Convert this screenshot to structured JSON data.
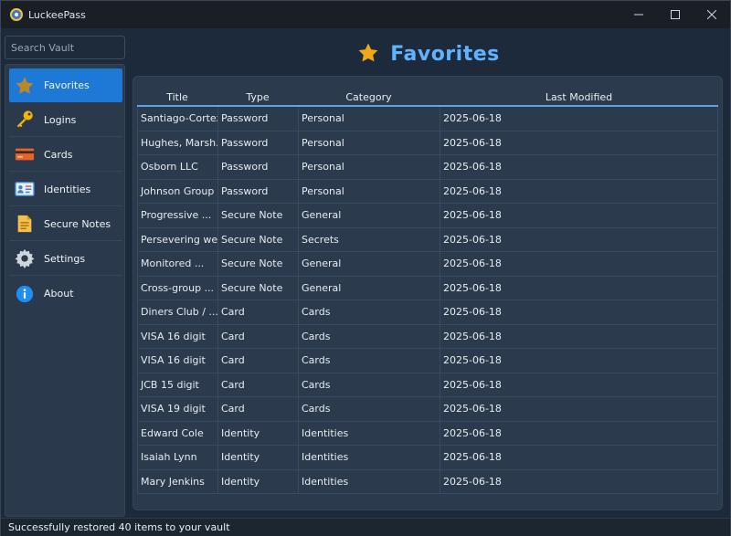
{
  "window": {
    "title": "LuckeePass"
  },
  "search": {
    "placeholder": "Search Vault"
  },
  "sidebar": {
    "items": [
      {
        "label": "Favorites",
        "icon": "star-icon",
        "active": true
      },
      {
        "label": "Logins",
        "icon": "key-icon",
        "active": false
      },
      {
        "label": "Cards",
        "icon": "credit-card-icon",
        "active": false
      },
      {
        "label": "Identities",
        "icon": "id-card-icon",
        "active": false
      },
      {
        "label": "Secure Notes",
        "icon": "note-icon",
        "active": false
      },
      {
        "label": "Settings",
        "icon": "gear-icon",
        "active": false
      },
      {
        "label": "About",
        "icon": "info-icon",
        "active": false
      }
    ]
  },
  "header": {
    "title": "Favorites"
  },
  "table": {
    "columns": [
      "Title",
      "Type",
      "Category",
      "Last Modified"
    ],
    "rows": [
      [
        "Santiago-Cortez",
        "Password",
        "Personal",
        "2025-06-18"
      ],
      [
        "Hughes, Marsh...",
        "Password",
        "Personal",
        "2025-06-18"
      ],
      [
        "Osborn LLC",
        "Password",
        "Personal",
        "2025-06-18"
      ],
      [
        "Johnson Group",
        "Password",
        "Personal",
        "2025-06-18"
      ],
      [
        "Progressive ...",
        "Secure Note",
        "General",
        "2025-06-18"
      ],
      [
        "Persevering we...",
        "Secure Note",
        "Secrets",
        "2025-06-18"
      ],
      [
        "Monitored ...",
        "Secure Note",
        "General",
        "2025-06-18"
      ],
      [
        "Cross-group ...",
        "Secure Note",
        "General",
        "2025-06-18"
      ],
      [
        "Diners Club / ...",
        "Card",
        "Cards",
        "2025-06-18"
      ],
      [
        "VISA 16 digit",
        "Card",
        "Cards",
        "2025-06-18"
      ],
      [
        "VISA 16 digit",
        "Card",
        "Cards",
        "2025-06-18"
      ],
      [
        "JCB 15 digit",
        "Card",
        "Cards",
        "2025-06-18"
      ],
      [
        "VISA 19 digit",
        "Card",
        "Cards",
        "2025-06-18"
      ],
      [
        "Edward Cole",
        "Identity",
        "Identities",
        "2025-06-18"
      ],
      [
        "Isaiah Lynn",
        "Identity",
        "Identities",
        "2025-06-18"
      ],
      [
        "Mary Jenkins",
        "Identity",
        "Identities",
        "2025-06-18"
      ]
    ]
  },
  "status": {
    "text": "Successfully restored 40 items to your vault"
  },
  "colors": {
    "accent": "#1e78d6",
    "title": "#5fb3ff",
    "star": "#f2a71b"
  }
}
